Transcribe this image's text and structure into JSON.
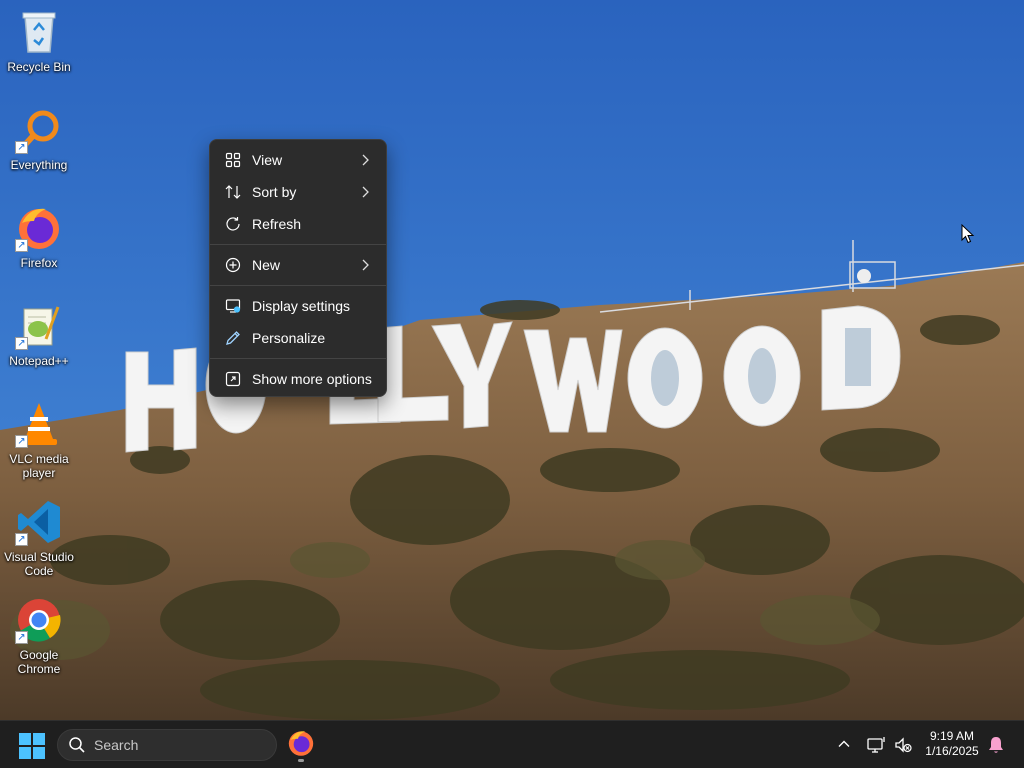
{
  "desktop": {
    "icons": [
      {
        "label": "Recycle Bin",
        "icon": "recycle-bin-icon",
        "shortcut": false
      },
      {
        "label": "Everything",
        "icon": "everything-search-icon",
        "shortcut": true
      },
      {
        "label": "Firefox",
        "icon": "firefox-icon",
        "shortcut": true
      },
      {
        "label": "Notepad++",
        "icon": "notepad-plus-plus-icon",
        "shortcut": true
      },
      {
        "label": "VLC media player",
        "icon": "vlc-icon",
        "shortcut": true
      },
      {
        "label": "Visual Studio Code",
        "icon": "vscode-icon",
        "shortcut": true
      },
      {
        "label": "Google Chrome",
        "icon": "chrome-icon",
        "shortcut": true
      }
    ],
    "wallpaper_sign_text": "HOLLYWOOD"
  },
  "context_menu": {
    "items": [
      {
        "label": "View",
        "icon": "view-grid-icon",
        "submenu": true
      },
      {
        "label": "Sort by",
        "icon": "sort-icon",
        "submenu": true
      },
      {
        "label": "Refresh",
        "icon": "refresh-icon",
        "submenu": false
      },
      {
        "label": "New",
        "icon": "new-plus-icon",
        "submenu": true
      },
      {
        "label": "Display settings",
        "icon": "display-settings-icon",
        "submenu": false
      },
      {
        "label": "Personalize",
        "icon": "personalize-pen-icon",
        "submenu": false
      },
      {
        "label": "Show more options",
        "icon": "more-options-icon",
        "submenu": false
      }
    ]
  },
  "taskbar": {
    "search_placeholder": "Search",
    "pinned_app": "firefox-icon",
    "clock_time": "9:19 AM",
    "clock_date": "1/16/2025"
  },
  "colors": {
    "sky": "#2f6fc6",
    "menu_bg": "#2c2c2c",
    "taskbar_bg": "#1f1f1f",
    "accent": "#0078d4"
  }
}
